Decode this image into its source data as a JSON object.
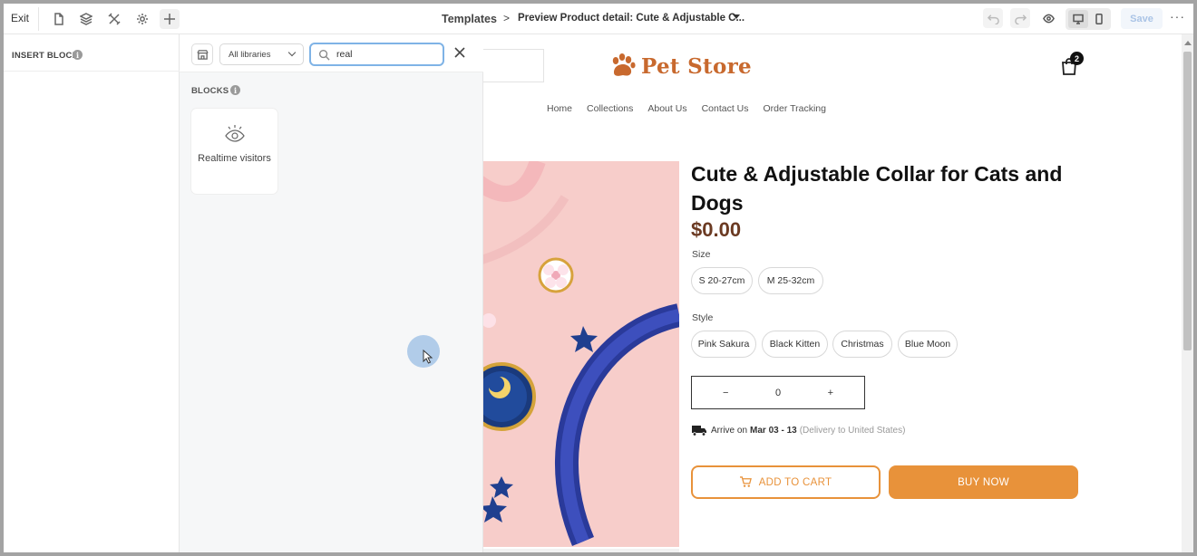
{
  "toolbar": {
    "exit_label": "Exit",
    "breadcrumb_root": "Templates",
    "breadcrumb_separator": ">",
    "breadcrumb_current": "Preview Product detail: Cute & Adjustable C...",
    "save_label": "Save",
    "more_label": "···",
    "icons": [
      "page-icon",
      "layers-icon",
      "tools-icon",
      "settings-icon",
      "plus-icon",
      "undo-icon",
      "redo-icon",
      "preview-eye-icon",
      "desktop-icon",
      "mobile-icon"
    ]
  },
  "insert_panel": {
    "title": "INSERT BLOCK",
    "info": "i"
  },
  "library": {
    "selected_library": "All libraries",
    "search_value": "real",
    "blocks_title": "BLOCKS",
    "blocks_info": "i",
    "blocks": [
      {
        "label": "Realtime visitors",
        "icon": "eye-icon"
      }
    ]
  },
  "store": {
    "name": "Pet Store",
    "cart_count": "2",
    "nav": [
      "Home",
      "Collections",
      "About Us",
      "Contact Us",
      "Order Tracking"
    ],
    "product": {
      "title": "Cute & Adjustable Collar for Cats and Dogs",
      "price": "$0.00",
      "size_label": "Size",
      "sizes": [
        "S 20-27cm",
        "M 25-32cm"
      ],
      "style_label": "Style",
      "styles": [
        "Pink Sakura",
        "Black Kitten",
        "Christmas",
        "Blue Moon"
      ],
      "qty_minus": "−",
      "qty_value": "0",
      "qty_plus": "+",
      "ship_prefix": "Arrive on",
      "ship_date": "Mar 03 - 13",
      "ship_note": "(Delivery to United States)",
      "add_to_cart": "ADD TO CART",
      "buy_now": "BUY NOW"
    }
  },
  "colors": {
    "accent_orange": "#e8923a",
    "logo_orange": "#c8692e",
    "price_brown": "#6b3a22",
    "search_focus": "#7fb3e6",
    "save_disabled": "#aac4e6"
  }
}
